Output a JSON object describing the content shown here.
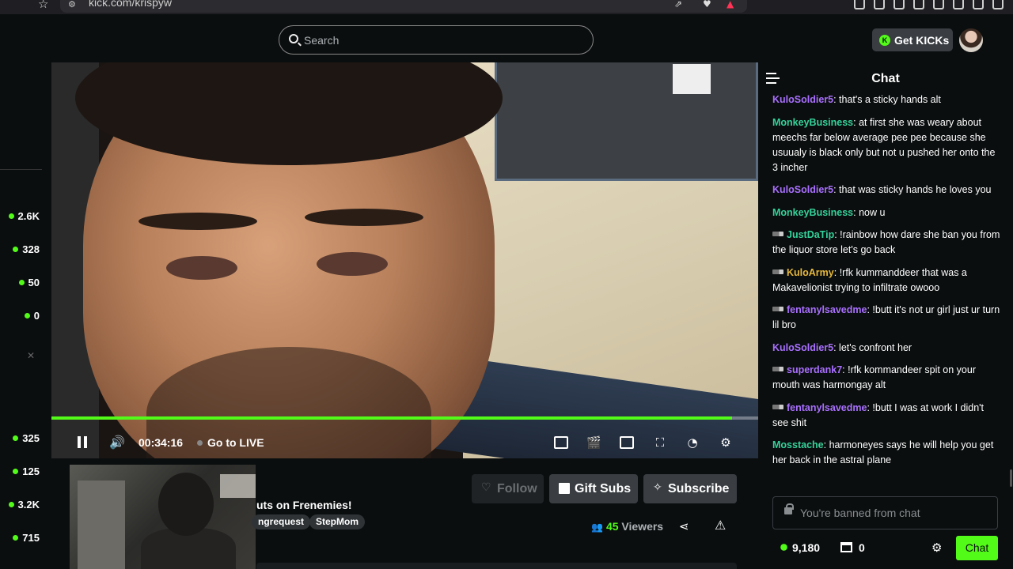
{
  "browser": {
    "url": "kick.com/krispyw"
  },
  "header": {
    "search_placeholder": "Search",
    "get_kicks_label": "Get KICKs",
    "get_kicks_coin": "K"
  },
  "sidebar": {
    "top_viewers": [
      "2.6K",
      "328",
      "50",
      "0"
    ],
    "bottom_viewers": [
      "325",
      "125",
      "3.2K",
      "715"
    ]
  },
  "player": {
    "progress": 0.963,
    "time": "00:34:16",
    "go_live_label": "Go to LIVE"
  },
  "stream": {
    "title_fragment": "uts on Frenemies!",
    "tags": [
      "ngrequest",
      "StepMom"
    ],
    "follow_label": "Follow",
    "gift_label": "Gift Subs",
    "subscribe_label": "Subscribe",
    "viewer_count": "45",
    "viewer_label": " Viewers"
  },
  "chat": {
    "title": "Chat",
    "messages": [
      {
        "user": "KuloSoldier5",
        "color": "#a970ff",
        "badge": false,
        "text": "that's a sticky hands alt"
      },
      {
        "user": "MonkeyBusiness",
        "color": "#35d29a",
        "badge": false,
        "text": "at first she was weary about meechs far below average pee pee because she usuualy is black only but not u pushed her onto the 3 incher"
      },
      {
        "user": "KuloSoldier5",
        "color": "#a970ff",
        "badge": false,
        "text": "that was sticky hands he loves you"
      },
      {
        "user": "MonkeyBusiness",
        "color": "#35d29a",
        "badge": false,
        "text": "now u"
      },
      {
        "user": "JustDaTip",
        "color": "#35d29a",
        "badge": true,
        "text": "!rainbow how dare she ban you from the liquor store let's go back"
      },
      {
        "user": "KuloArmy",
        "color": "#e7b93c",
        "badge": true,
        "text": "!rfk kummanddeer that was a Makavelionist trying to infiltrate owooo"
      },
      {
        "user": "fentanylsavedme",
        "color": "#a970ff",
        "badge": true,
        "text": "!butt it's not ur girl just ur turn lil bro"
      },
      {
        "user": "KuloSoldier5",
        "color": "#a970ff",
        "badge": false,
        "text": "let's confront her"
      },
      {
        "user": "superdank7",
        "color": "#a970ff",
        "badge": true,
        "text": "!rfk kommandeer spit on your mouth was harmongay alt"
      },
      {
        "user": "fentanylsavedme",
        "color": "#a970ff",
        "badge": true,
        "text": "!butt I was at work I didn't see shit"
      },
      {
        "user": "Mosstache",
        "color": "#35d29a",
        "badge": false,
        "text": "harmoneyes says he will help you get her back in the astral plane"
      }
    ],
    "banned_text": "You're banned from chat",
    "points": "9,180",
    "store_count": "0",
    "send_label": "Chat"
  }
}
